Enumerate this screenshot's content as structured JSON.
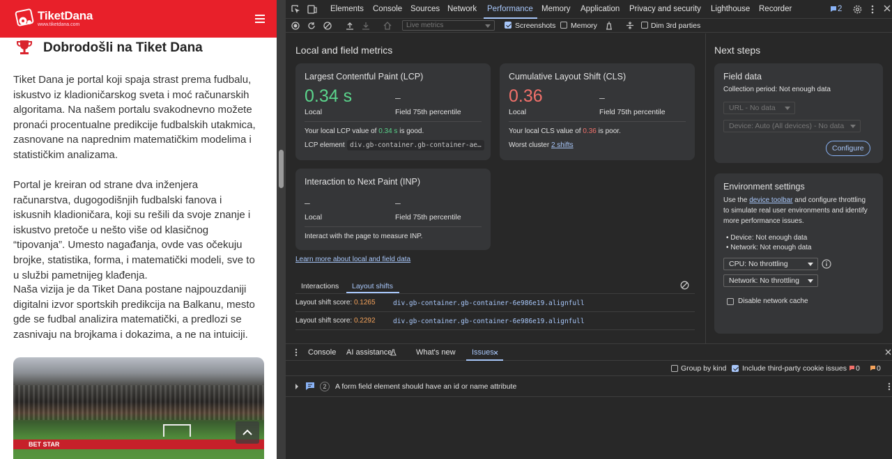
{
  "site": {
    "logo_name": "TiketDana",
    "logo_url": "www.tiketdana.com",
    "title": "Dobrodošli na Tiket Dana",
    "paragraphs": [
      "Tiket Dana je portal koji spaja strast prema fudbalu, iskustvo iz kladioničarskog sveta i moć računarskih algoritama. Na našem portalu svakodnevno možete pronaći procentualne predikcije fudbalskih utakmica, zasnovane na naprednim matematičkim modelima i statističkim analizama.",
      "Portal je kreiran od strane dva inženjera računarstva, dugogodišnjih fudbalski fanova i iskusnih kladioničara, koji su rešili da svoje znanje i iskustvo pretoče u nešto više od klasičnog “tipovanja”. Umesto nagađanja, ovde vas očekuju brojke, statistika, forma, i matematički modeli, sve to u službi pametnijeg klađenja.",
      "Naša vizija je da Tiket Dana postane najpouzdaniji digitalni izvor sportskih predikcija na Balkanu, mesto gde se fudbal analizira matematički, a predlozi se zasnivaju na brojkama i dokazima, a ne na intuiciji."
    ],
    "hero_banner": "BET STAR"
  },
  "devtools": {
    "tabs": [
      "Elements",
      "Console",
      "Sources",
      "Network",
      "Performance",
      "Memory",
      "Application",
      "Privacy and security",
      "Lighthouse",
      "Recorder"
    ],
    "issues_count": "2",
    "toolbar": {
      "live_metrics": "Live metrics",
      "screenshots": "Screenshots",
      "memory": "Memory",
      "dim_3rd": "Dim 3rd parties"
    },
    "local_field": {
      "heading": "Local and field metrics",
      "lcp": {
        "title": "Largest Contentful Paint (LCP)",
        "value": "0.34 s",
        "local_label": "Local",
        "field_value": "–",
        "field_label": "Field 75th percentile",
        "note_prefix": "Your local LCP value of ",
        "note_value": "0.34 s",
        "note_suffix": " is good.",
        "element_label": "LCP element",
        "element_value": "div.gb-container.gb-container-ae…"
      },
      "cls": {
        "title": "Cumulative Layout Shift (CLS)",
        "value": "0.36",
        "local_label": "Local",
        "field_value": "–",
        "field_label": "Field 75th percentile",
        "note_prefix": "Your local CLS value of ",
        "note_value": "0.36",
        "note_suffix": " is poor.",
        "worst_label": "Worst cluster",
        "worst_value": "2 shifts"
      },
      "inp": {
        "title": "Interaction to Next Paint (INP)",
        "local_value": "–",
        "local_label": "Local",
        "field_value": "–",
        "field_label": "Field 75th percentile",
        "note": "Interact with the page to measure INP."
      },
      "learn_more": "Learn more about local and field data",
      "subtabs": [
        "Interactions",
        "Layout shifts"
      ],
      "shifts": [
        {
          "label": "Layout shift score: ",
          "score": "0.1265",
          "element": "div.gb-container.gb-container-6e986e19.alignfull"
        },
        {
          "label": "Layout shift score: ",
          "score": "0.2292",
          "element": "div.gb-container.gb-container-6e986e19.alignfull"
        }
      ]
    },
    "next_steps": {
      "heading": "Next steps",
      "field_data": {
        "title": "Field data",
        "period_label": "Collection period: ",
        "period_value": "Not enough data",
        "url_select": "URL - No data",
        "device_select": "Device: Auto (All devices) - No data",
        "configure": "Configure"
      },
      "env": {
        "title": "Environment settings",
        "desc_pre": "Use the ",
        "desc_link": "device toolbar",
        "desc_post1": " and configure throttling",
        "desc_line2": "to simulate real user environments and identify",
        "desc_line3": "more performance issues.",
        "device_label": "Device: ",
        "device_value": "Not enough data",
        "network_label": "Network: ",
        "network_value": "Not enough data",
        "cpu_select": "CPU: No throttling",
        "net_select": "Network: No throttling",
        "disable_cache": "Disable network cache"
      }
    },
    "drawer": {
      "tabs": [
        "Console",
        "AI assistance",
        "What's new",
        "Issues"
      ],
      "group_by_kind": "Group by kind",
      "include_third": "Include third-party cookie issues",
      "err_count": "0",
      "warn_count": "0",
      "issue_count": "2",
      "issue_text": "A form field element should have an id or name attribute"
    }
  },
  "colors": {
    "good": "#5bd58c",
    "poor": "#f2716b",
    "accent": "#a8c7fa",
    "brand": "#e8202a"
  }
}
